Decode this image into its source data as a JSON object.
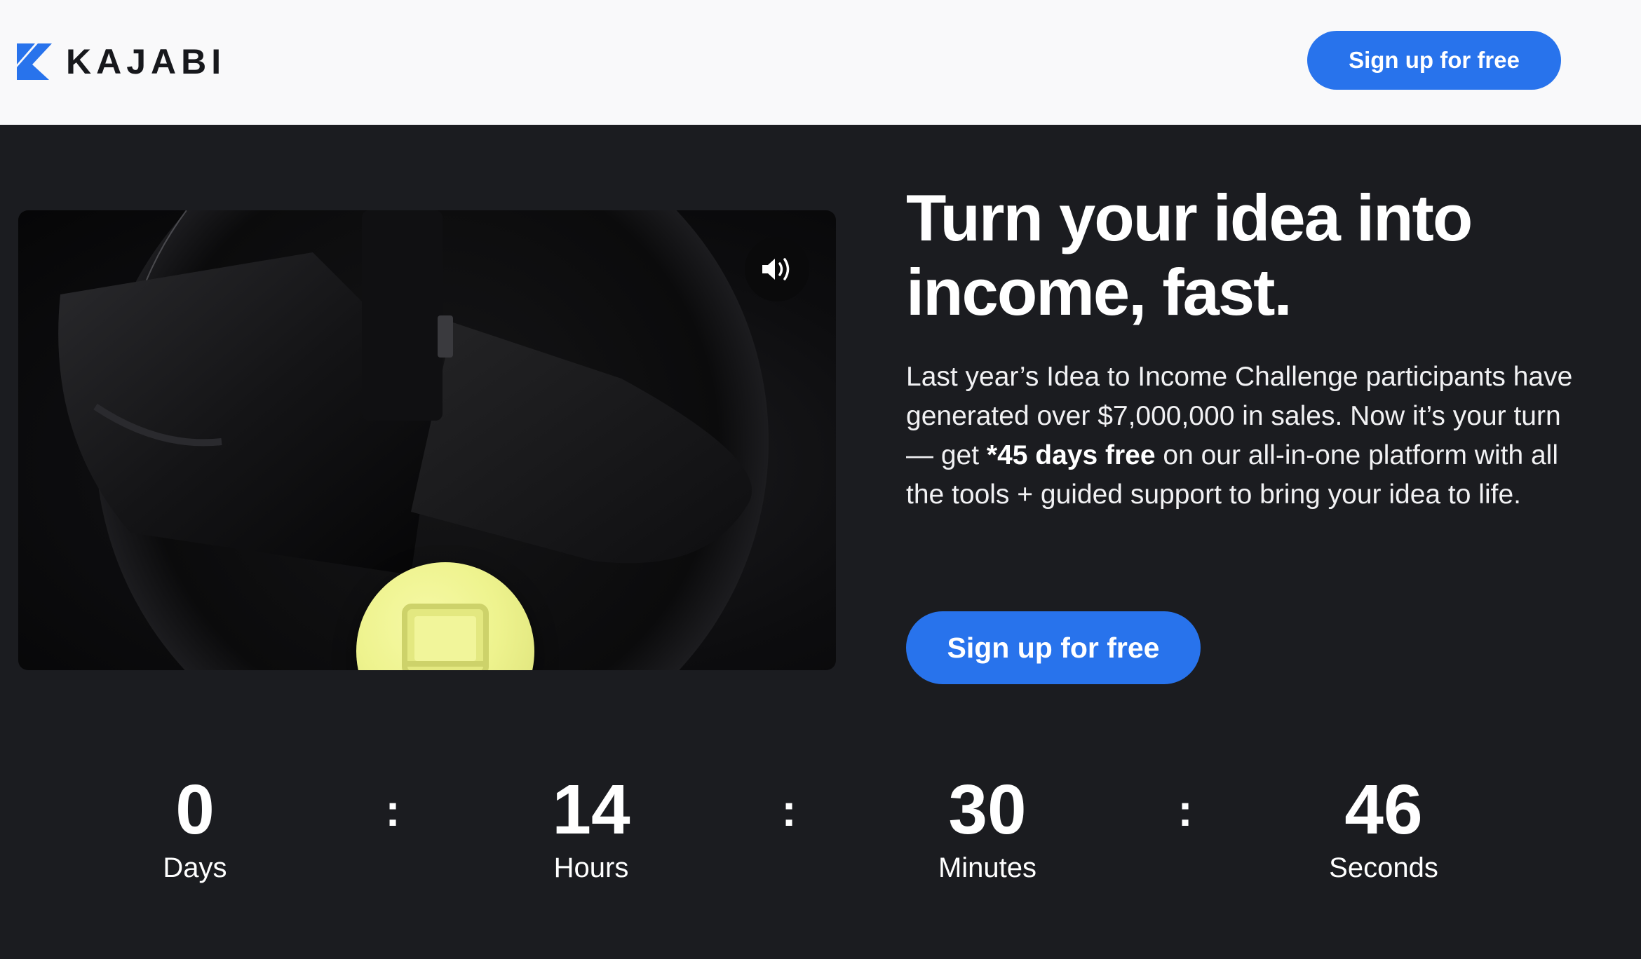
{
  "header": {
    "logo_text": "KAJABI",
    "cta_label": "Sign up for free"
  },
  "video": {
    "mute_icon": "speaker-volume-icon",
    "badge_icon": "monitor-icon"
  },
  "hero": {
    "headline": "Turn your idea into income, fast.",
    "body_part1": "Last year’s Idea to Income Challenge participants have generated over $7,000,000 in sales. Now it’s your turn — get ",
    "body_bold": "*45 days free",
    "body_part2": " on our all-in-one platform with all the tools + guided support to bring your idea to life.",
    "cta_label": "Sign up for free"
  },
  "countdown": {
    "separator": ":",
    "units": [
      {
        "value": "0",
        "label": "Days"
      },
      {
        "value": "14",
        "label": "Hours"
      },
      {
        "value": "30",
        "label": "Minutes"
      },
      {
        "value": "46",
        "label": "Seconds"
      }
    ]
  },
  "colors": {
    "brand_blue": "#2873ec",
    "page_dark": "#1b1c20",
    "header_bg": "#f9f9fa",
    "badge_yellow": "#eef38e"
  }
}
